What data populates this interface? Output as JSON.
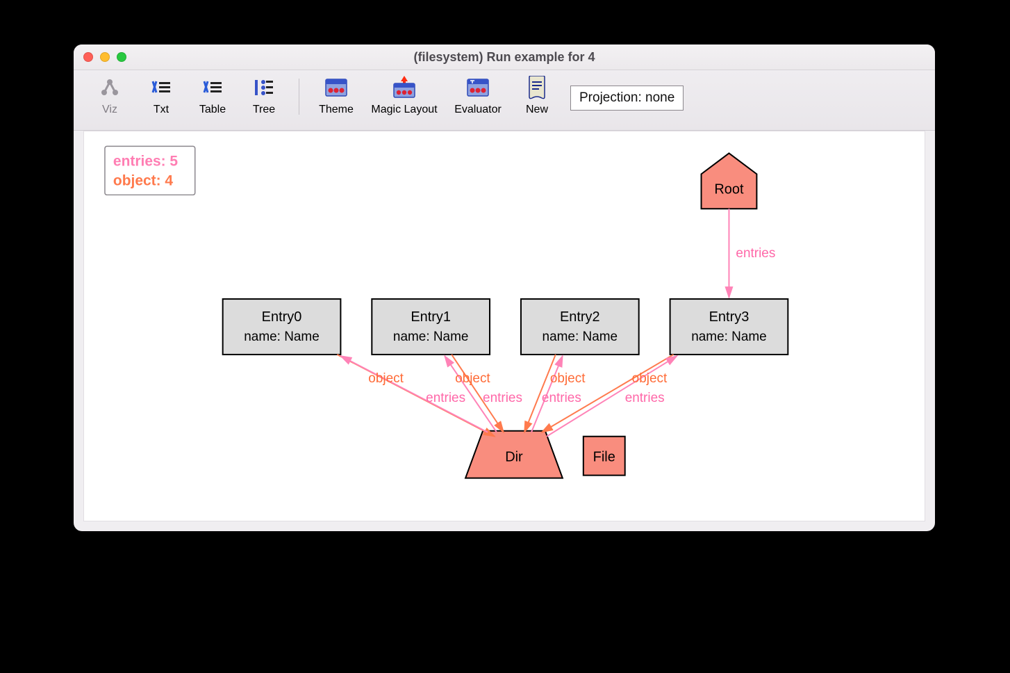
{
  "window": {
    "title": "(filesystem) Run example for 4"
  },
  "toolbar": {
    "viz": "Viz",
    "txt": "Txt",
    "table": "Table",
    "tree": "Tree",
    "theme": "Theme",
    "magic_layout": "Magic Layout",
    "evaluator": "Evaluator",
    "new": "New",
    "projection": "Projection: none"
  },
  "legend": {
    "entries_line": "entries: 5",
    "object_line": "object: 4"
  },
  "nodes": {
    "root": "Root",
    "entry0_title": "Entry0",
    "entry0_sub": "name: Name",
    "entry1_title": "Entry1",
    "entry1_sub": "name: Name",
    "entry2_title": "Entry2",
    "entry2_sub": "name: Name",
    "entry3_title": "Entry3",
    "entry3_sub": "name: Name",
    "dir": "Dir",
    "file": "File"
  },
  "edge_labels": {
    "entries": "entries",
    "object": "object"
  }
}
